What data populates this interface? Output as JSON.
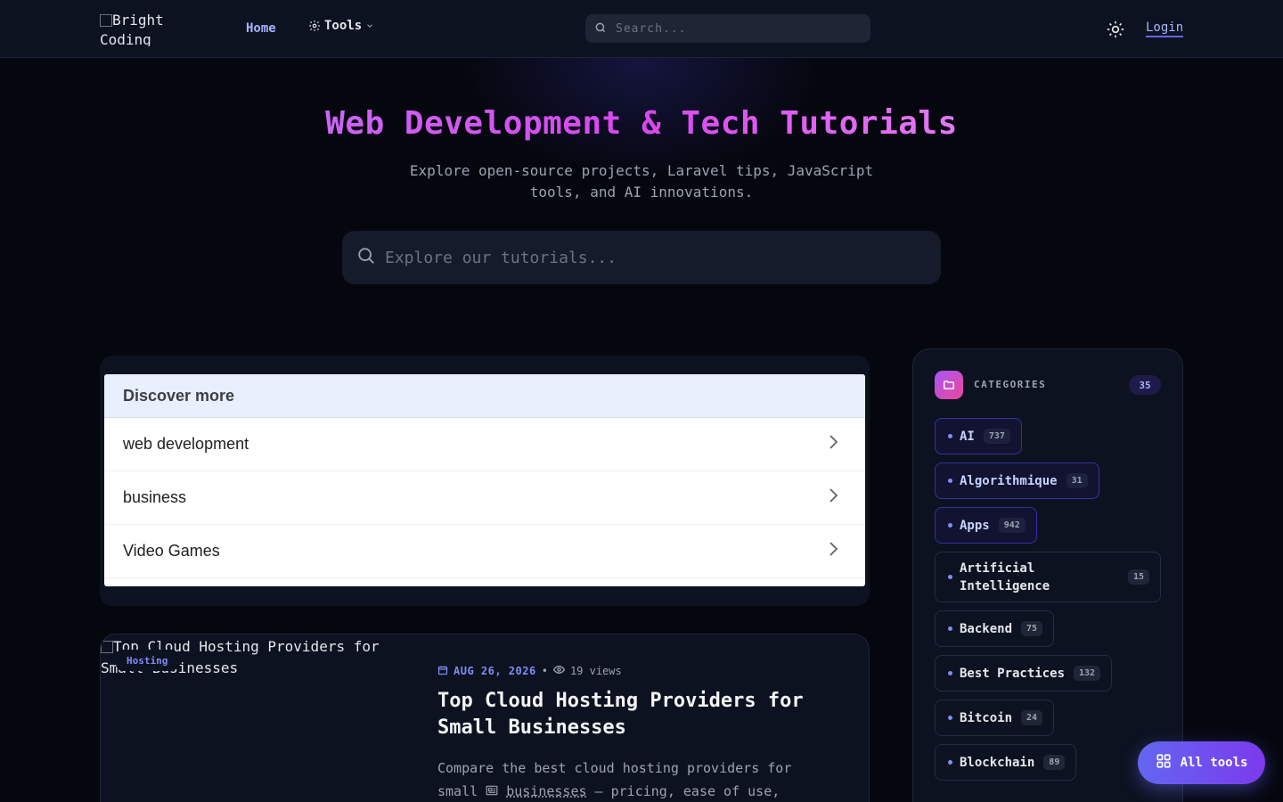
{
  "header": {
    "logo_alt": "Bright Coding",
    "nav_home": "Home",
    "nav_tools": "Tools",
    "search_placeholder": "Search...",
    "login": "Login"
  },
  "hero": {
    "title": "Web Development & Tech Tutorials",
    "subtitle": "Explore open-source projects, Laravel tips, JavaScript tools, and AI innovations.",
    "search_placeholder": "Explore our tutorials..."
  },
  "discover": {
    "heading": "Discover more",
    "items": [
      {
        "label": "web development"
      },
      {
        "label": "business"
      },
      {
        "label": "Video Games"
      }
    ]
  },
  "article": {
    "image_alt": "Top Cloud Hosting Providers for Small Businesses",
    "badge": "Hosting",
    "date": "AUG 26, 2026",
    "views": "19 views",
    "title": "Top Cloud Hosting Providers for Small Businesses",
    "excerpt_before": "Compare the best cloud hosting providers for small ",
    "excerpt_link": "businesses",
    "excerpt_after": " — pricing, ease of use,"
  },
  "categories": {
    "label": "CATEGORIES",
    "count": "35",
    "items": [
      {
        "name": "AI",
        "count": "737"
      },
      {
        "name": "Algorithmique",
        "count": "31"
      },
      {
        "name": "Apps",
        "count": "942"
      },
      {
        "name": "Artificial Intelligence",
        "count": "15"
      },
      {
        "name": "Backend",
        "count": "75"
      },
      {
        "name": "Best Practices",
        "count": "132"
      },
      {
        "name": "Bitcoin",
        "count": "24"
      },
      {
        "name": "Blockchain",
        "count": "89"
      }
    ]
  },
  "fab": {
    "label": "All tools"
  },
  "colors": {
    "accent": "#6366f1",
    "background": "#05070f",
    "title_gradient_start": "#c084fc",
    "title_gradient_end": "#f0abfc"
  }
}
